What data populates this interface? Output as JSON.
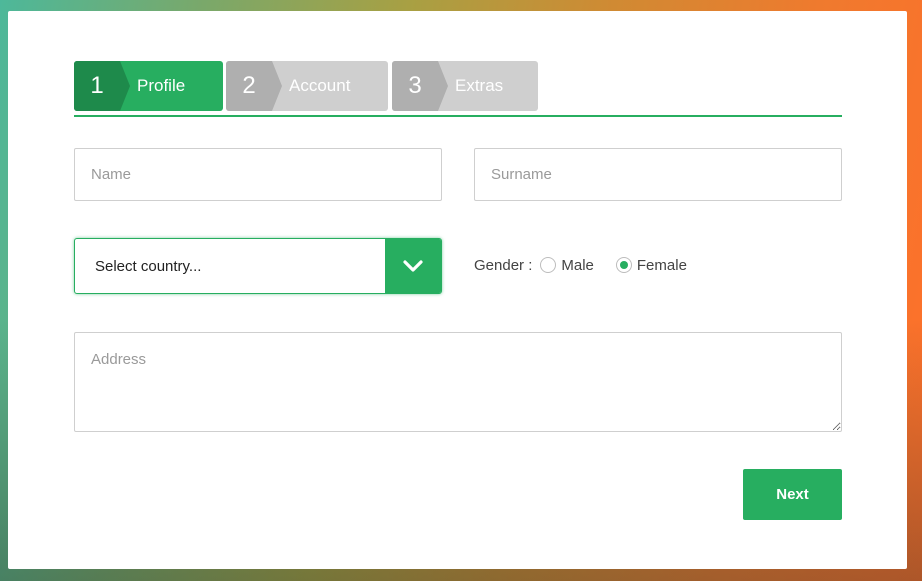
{
  "wizard": {
    "steps": [
      {
        "number": "1",
        "label": "Profile",
        "state": "active"
      },
      {
        "number": "2",
        "label": "Account",
        "state": "inactive"
      },
      {
        "number": "3",
        "label": "Extras",
        "state": "inactive"
      }
    ]
  },
  "form": {
    "name_placeholder": "Name",
    "name_value": "",
    "surname_placeholder": "Surname",
    "surname_value": "",
    "country_select": {
      "selected": "Select country...",
      "icon": "chevron-down-icon"
    },
    "gender": {
      "label": "Gender :",
      "options": [
        {
          "label": "Male",
          "checked": false
        },
        {
          "label": "Female",
          "checked": true
        }
      ]
    },
    "address_placeholder": "Address",
    "address_value": "",
    "next_label": "Next"
  },
  "colors": {
    "accent": "#27ae60",
    "accent_dark": "#1e8a4b",
    "inactive_step": "#cfcfcf",
    "inactive_step_num": "#afafaf"
  }
}
